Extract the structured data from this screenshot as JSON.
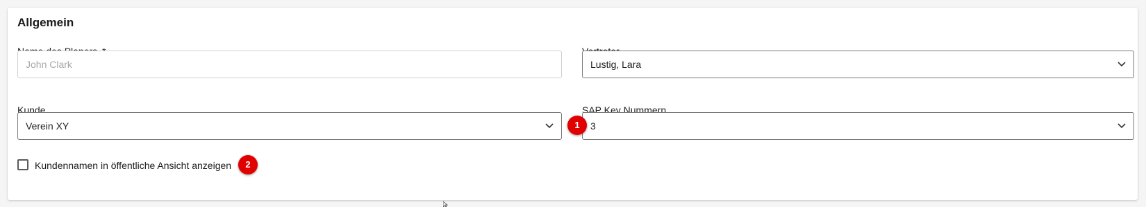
{
  "section": {
    "title": "Allgemein"
  },
  "planer": {
    "label": "Name des Planers",
    "required_mark": "*",
    "value": "",
    "placeholder": "John Clark"
  },
  "vertreter": {
    "label": "Vertreter",
    "value": "Lustig, Lara"
  },
  "kunde": {
    "label": "Kunde",
    "value": "Verein XY"
  },
  "sap": {
    "label": "SAP Key Nummern",
    "value": "3"
  },
  "checkbox": {
    "label": "Kundennamen in öffentliche Ansicht anzeigen",
    "checked": false
  },
  "badges": {
    "one": "1",
    "two": "2"
  },
  "colors": {
    "badge": "#e00000",
    "select_border": "#7a7a7a",
    "input_border": "#d0d0d0"
  }
}
